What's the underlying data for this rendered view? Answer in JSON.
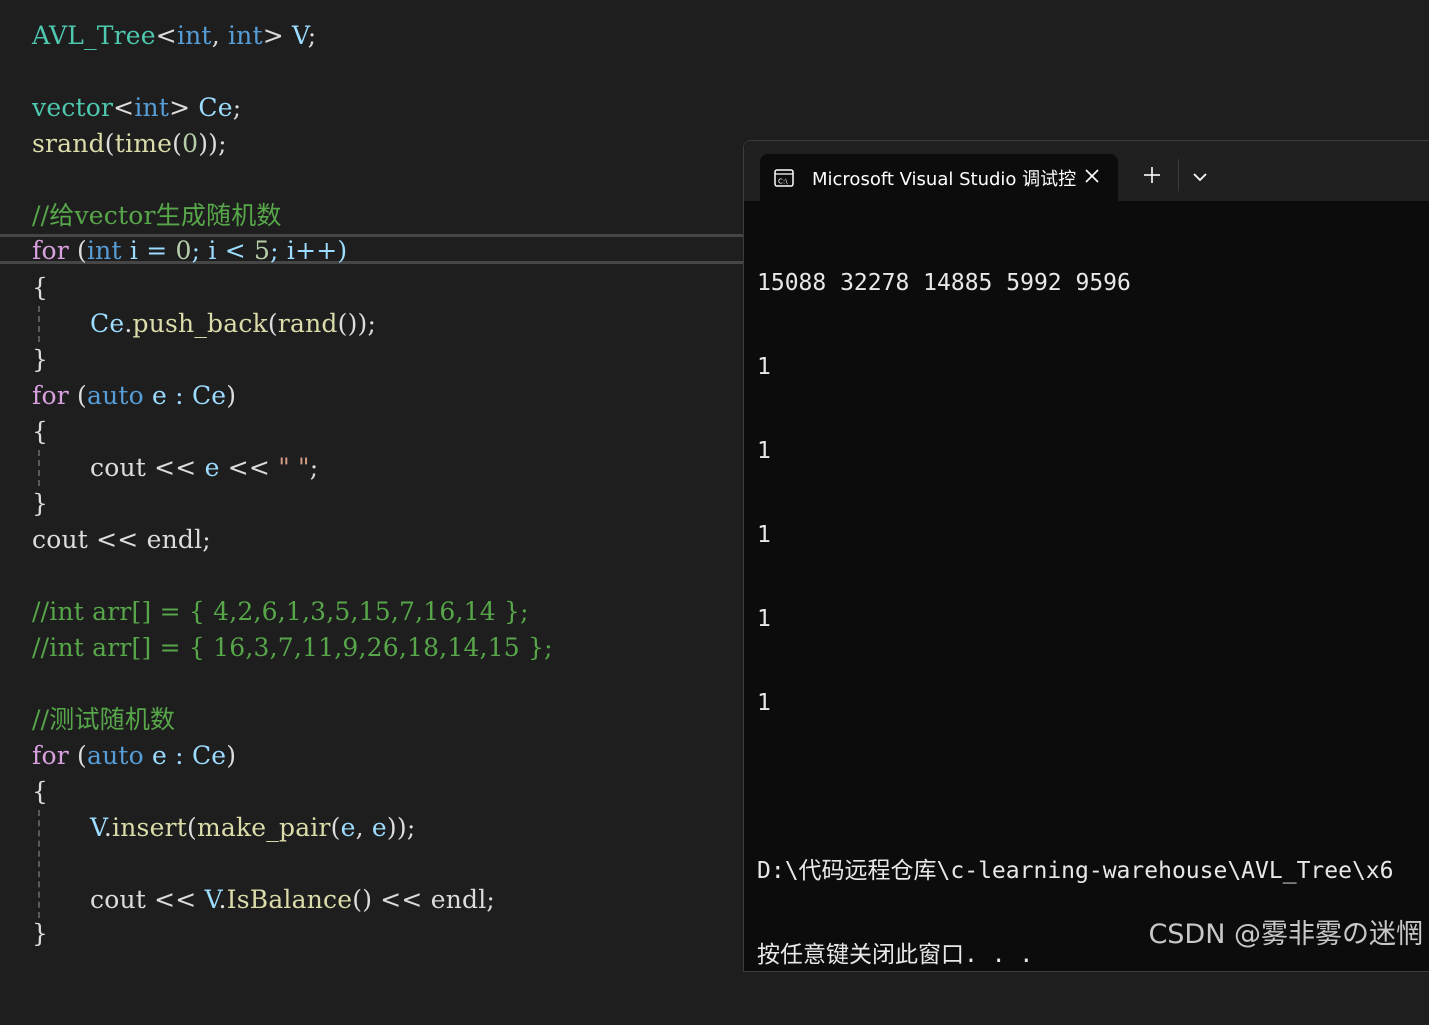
{
  "editor": {
    "l1": {
      "t1": "AVL_Tree",
      "t2": "<",
      "t3": "int",
      "t4": ", ",
      "t5": "int",
      "t6": "> ",
      "t7": "V",
      ";": ";"
    },
    "l3": {
      "t1": "vector",
      "t2": "<",
      "t3": "int",
      "t4": "> ",
      "t5": "Ce",
      "t6": ";"
    },
    "l4": {
      "t1": "srand",
      "t2": "(",
      "t3": "time",
      "t4": "(",
      "t5": "0",
      "t6": "));"
    },
    "l6": {
      "comment": "//给vector生成随机数"
    },
    "l7": {
      "t1": "for",
      "t2": " (",
      "t3": "int",
      "t4": " i = ",
      "t5": "0",
      "t6": "; i < ",
      "t7": "5",
      "t8": "; i++)"
    },
    "l8": {
      "t1": "{"
    },
    "l9": {
      "t1": "Ce",
      "t2": ".",
      "t3": "push_back",
      "t4": "(",
      "t5": "rand",
      "t6": "());"
    },
    "l10": {
      "t1": "}"
    },
    "l11": {
      "t1": "for",
      "t2": " (",
      "t3": "auto",
      "t4": " e : ",
      "t5": "Ce",
      ")": ")"
    },
    "l12": {
      "t1": "{"
    },
    "l13": {
      "t1": "cout << ",
      "t2": "e",
      "t3": " << ",
      "t4": "\" \"",
      "t5": ";"
    },
    "l14": {
      "t1": "}"
    },
    "l15": {
      "t1": "cout << endl;"
    },
    "l17": {
      "comment": "//int arr[] = { 4,2,6,1,3,5,15,7,16,14 };"
    },
    "l18": {
      "comment": "//int arr[] = { 16,3,7,11,9,26,18,14,15 };"
    },
    "l20": {
      "comment": "//测试随机数"
    },
    "l21": {
      "t1": "for",
      "t2": " (",
      "t3": "auto",
      "t4": " e : ",
      "t5": "Ce",
      ")": ")"
    },
    "l22": {
      "t1": "{"
    },
    "l23": {
      "t1": "V",
      "t2": ".",
      "t3": "insert",
      "t4": "(",
      "t5": "make_pair",
      "t6": "(",
      "t7": "e",
      ",": ", ",
      "t8": "e",
      "t9": "));"
    },
    "l25": {
      "t1": "cout << ",
      "t2": "V",
      "t3": ".",
      "t4": "IsBalance",
      "t5": "() << endl;"
    },
    "l26": {
      "t1": "}"
    }
  },
  "terminal": {
    "tab_title": "Microsoft Visual Studio 调试控",
    "tab_icon": "terminal-icon",
    "output": [
      "15088 32278 14885 5992 9596",
      "1",
      "1",
      "1",
      "1",
      "1",
      "",
      "D:\\代码远程仓库\\c-learning-warehouse\\AVL_Tree\\x6",
      "按任意键关闭此窗口. . ."
    ]
  },
  "watermark": "CSDN @雾非雾の迷惘",
  "colors": {
    "keyword": "#569cd6",
    "type": "#4ec9b0",
    "function": "#dcdcaa",
    "variable": "#9cdcfe",
    "number": "#b5cea8",
    "comment": "#57a64a"
  }
}
